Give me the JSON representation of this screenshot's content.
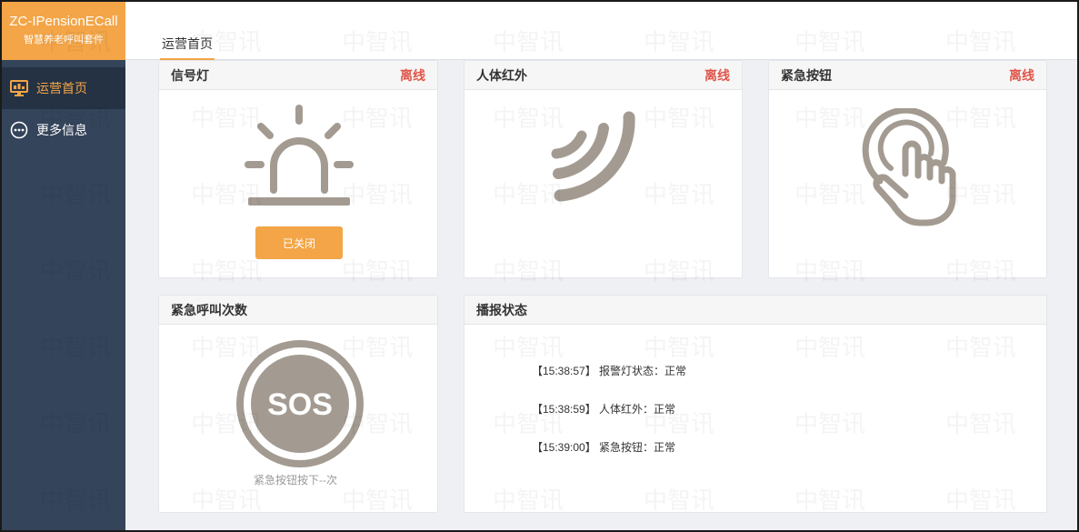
{
  "app": {
    "title": "ZC-IPensionECall",
    "subtitle": "智慧养老呼叫套件"
  },
  "sidebar": {
    "items": [
      {
        "label": "运营首页",
        "icon": "monitor-icon",
        "active": true
      },
      {
        "label": "更多信息",
        "icon": "more-icon",
        "active": false
      }
    ]
  },
  "header": {
    "tabs": [
      {
        "label": "运营首页"
      }
    ]
  },
  "cards": {
    "signal_light": {
      "title": "信号灯",
      "status": "离线",
      "button_label": "已关闭",
      "icon": "alarm-light-icon"
    },
    "infrared": {
      "title": "人体红外",
      "status": "离线",
      "icon": "infrared-waves-icon"
    },
    "emergency_button": {
      "title": "紧急按钮",
      "status": "离线",
      "icon": "finger-press-icon"
    },
    "call_count": {
      "title": "紧急呼叫次数",
      "sos_text": "SOS",
      "caption": "紧急按钮按下--次",
      "icon": "sos-icon"
    },
    "broadcast": {
      "title": "播报状态",
      "logs": [
        "【15:38:57】 报警灯状态：正常",
        "【15:38:59】 人体红外：正常",
        "【15:39:00】 紧急按钮：正常"
      ]
    }
  },
  "watermark": "中智讯",
  "colors": {
    "accent": "#f3a547",
    "sidebar": "#34445a",
    "sidebar_active": "#253243",
    "offline": "#e0564a",
    "icon_gray": "#a39b91"
  }
}
